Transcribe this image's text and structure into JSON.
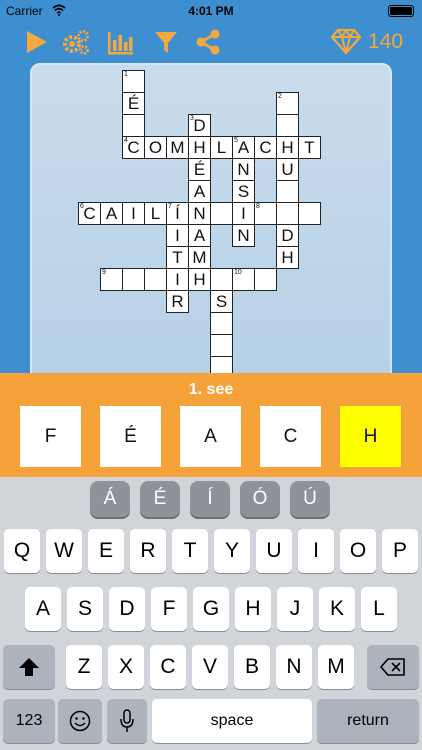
{
  "status": {
    "carrier": "Carrier",
    "time": "4:01 PM"
  },
  "toolbar": {
    "icons": [
      "play-icon",
      "settings-gears-icon",
      "stats-chart-icon",
      "filter-icon",
      "share-icon",
      "gem-icon"
    ],
    "gem_count": "140",
    "accent_color": "#f5a840"
  },
  "grid": {
    "cells": [
      {
        "c": 4,
        "r": 0,
        "l": "",
        "n": "1"
      },
      {
        "c": 4,
        "r": 1,
        "l": "É",
        "n": ""
      },
      {
        "c": 4,
        "r": 2,
        "l": "",
        "n": ""
      },
      {
        "c": 4,
        "r": 3,
        "l": "C",
        "n": "4"
      },
      {
        "c": 5,
        "r": 3,
        "l": "O",
        "n": ""
      },
      {
        "c": 6,
        "r": 3,
        "l": "M",
        "n": ""
      },
      {
        "c": 7,
        "r": 3,
        "l": "H",
        "n": ""
      },
      {
        "c": 8,
        "r": 3,
        "l": "L",
        "n": ""
      },
      {
        "c": 9,
        "r": 3,
        "l": "A",
        "n": "5"
      },
      {
        "c": 10,
        "r": 3,
        "l": "C",
        "n": ""
      },
      {
        "c": 11,
        "r": 3,
        "l": "H",
        "n": ""
      },
      {
        "c": 12,
        "r": 3,
        "l": "T",
        "n": ""
      },
      {
        "c": 7,
        "r": 2,
        "l": "D",
        "n": "3"
      },
      {
        "c": 7,
        "r": 4,
        "l": "É",
        "n": ""
      },
      {
        "c": 7,
        "r": 5,
        "l": "A",
        "n": ""
      },
      {
        "c": 7,
        "r": 6,
        "l": "N",
        "n": ""
      },
      {
        "c": 7,
        "r": 7,
        "l": "A",
        "n": ""
      },
      {
        "c": 7,
        "r": 8,
        "l": "M",
        "n": ""
      },
      {
        "c": 7,
        "r": 9,
        "l": "H",
        "n": ""
      },
      {
        "c": 9,
        "r": 4,
        "l": "N",
        "n": ""
      },
      {
        "c": 9,
        "r": 5,
        "l": "S",
        "n": ""
      },
      {
        "c": 9,
        "r": 6,
        "l": "I",
        "n": ""
      },
      {
        "c": 9,
        "r": 7,
        "l": "N",
        "n": ""
      },
      {
        "c": 11,
        "r": 1,
        "l": "",
        "n": "2"
      },
      {
        "c": 11,
        "r": 2,
        "l": "",
        "n": ""
      },
      {
        "c": 11,
        "r": 4,
        "l": "U",
        "n": ""
      },
      {
        "c": 11,
        "r": 5,
        "l": "",
        "n": ""
      },
      {
        "c": 11,
        "r": 6,
        "l": "",
        "n": ""
      },
      {
        "c": 11,
        "r": 7,
        "l": "D",
        "n": ""
      },
      {
        "c": 11,
        "r": 8,
        "l": "H",
        "n": ""
      },
      {
        "c": 2,
        "r": 6,
        "l": "C",
        "n": "6"
      },
      {
        "c": 3,
        "r": 6,
        "l": "A",
        "n": ""
      },
      {
        "c": 4,
        "r": 6,
        "l": "I",
        "n": ""
      },
      {
        "c": 5,
        "r": 6,
        "l": "L",
        "n": ""
      },
      {
        "c": 6,
        "r": 6,
        "l": "Í",
        "n": "7"
      },
      {
        "c": 8,
        "r": 6,
        "l": "",
        "n": ""
      },
      {
        "c": 10,
        "r": 6,
        "l": "",
        "n": "8"
      },
      {
        "c": 12,
        "r": 6,
        "l": "",
        "n": ""
      },
      {
        "c": 6,
        "r": 7,
        "l": "I",
        "n": ""
      },
      {
        "c": 6,
        "r": 8,
        "l": "T",
        "n": ""
      },
      {
        "c": 6,
        "r": 9,
        "l": "I",
        "n": ""
      },
      {
        "c": 6,
        "r": 10,
        "l": "R",
        "n": ""
      },
      {
        "c": 3,
        "r": 9,
        "l": "",
        "n": "9"
      },
      {
        "c": 4,
        "r": 9,
        "l": "",
        "n": ""
      },
      {
        "c": 5,
        "r": 9,
        "l": "",
        "n": ""
      },
      {
        "c": 8,
        "r": 9,
        "l": "",
        "n": ""
      },
      {
        "c": 9,
        "r": 9,
        "l": "",
        "n": "10"
      },
      {
        "c": 10,
        "r": 9,
        "l": "",
        "n": ""
      },
      {
        "c": 8,
        "r": 10,
        "l": "S",
        "n": ""
      },
      {
        "c": 8,
        "r": 11,
        "l": "",
        "n": ""
      },
      {
        "c": 8,
        "r": 12,
        "l": "",
        "n": ""
      },
      {
        "c": 8,
        "r": 13,
        "l": "",
        "n": ""
      }
    ]
  },
  "clue": {
    "title": "1. see",
    "answer_letters": [
      "F",
      "É",
      "A",
      "C",
      "H"
    ],
    "active_index": 4,
    "active_color": "#ffff00"
  },
  "keyboard": {
    "accents": [
      "Á",
      "É",
      "Í",
      "Ó",
      "Ú"
    ],
    "row1": [
      "Q",
      "W",
      "E",
      "R",
      "T",
      "Y",
      "U",
      "I",
      "O",
      "P"
    ],
    "row2": [
      "A",
      "S",
      "D",
      "F",
      "G",
      "H",
      "J",
      "K",
      "L"
    ],
    "row3": [
      "Z",
      "X",
      "C",
      "V",
      "B",
      "N",
      "M"
    ],
    "numbers_label": "123",
    "space_label": "space",
    "return_label": "return",
    "icons": [
      "shift-icon",
      "backspace-icon",
      "emoji-icon",
      "microphone-icon"
    ]
  }
}
